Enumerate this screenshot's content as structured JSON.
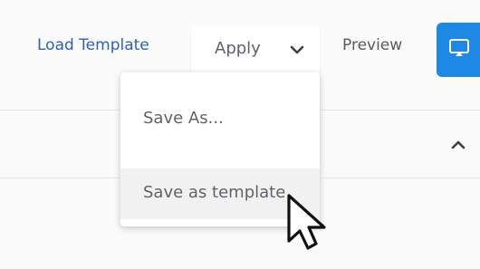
{
  "toolbar": {
    "load_template_label": "Load Template",
    "apply_label": "Apply",
    "preview_label": "Preview",
    "icons": {
      "apply_dropdown": "chevron-down-icon",
      "present": "present-screen-icon"
    }
  },
  "dropdown_menu": {
    "items": [
      {
        "label": "Save As..."
      },
      {
        "label": "Save as template",
        "hovered": true
      }
    ]
  },
  "section": {
    "toggle_icon": "chevron-up-icon"
  },
  "colors": {
    "link": "#2d61b5",
    "accent": "#1e88e5",
    "text_muted": "#5f6368",
    "hover_bg": "#f1f1f1"
  }
}
